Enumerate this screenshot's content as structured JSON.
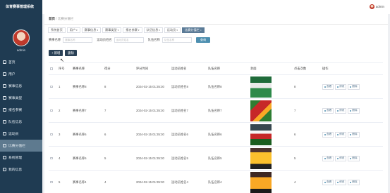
{
  "app": {
    "title": "体育赛事管理系统"
  },
  "user": {
    "name": "admin"
  },
  "sidebar": {
    "profile_name": "admin",
    "items": [
      {
        "label": "首页",
        "icon": "home-icon"
      },
      {
        "label": "用户",
        "icon": "user-icon"
      },
      {
        "label": "赛事信息",
        "icon": "info-icon"
      },
      {
        "label": "赛事类型",
        "icon": "type-icon"
      },
      {
        "label": "报名参赛",
        "icon": "signup-icon"
      },
      {
        "label": "队伍信息",
        "icon": "team-icon"
      },
      {
        "label": "运动员",
        "icon": "athlete-icon"
      },
      {
        "label": "比赛分值栏",
        "icon": "score-icon",
        "active": true
      },
      {
        "label": "系统管理",
        "icon": "system-icon"
      },
      {
        "label": "我的信息",
        "icon": "profile-icon"
      }
    ]
  },
  "breadcrumb": {
    "home": "首页",
    "sep": "/",
    "current": "比赛分值栏"
  },
  "tabs": [
    {
      "label": "系统首页",
      "caret": false
    },
    {
      "label": "用户",
      "caret": true
    },
    {
      "label": "赛事信息",
      "caret": true
    },
    {
      "label": "赛事类型",
      "caret": true
    },
    {
      "label": "报名参赛",
      "caret": true
    },
    {
      "label": "队伍信息",
      "caret": true
    },
    {
      "label": "运动员",
      "caret": true
    },
    {
      "label": "比赛分值栏",
      "caret": true,
      "active": true
    }
  ],
  "filters": {
    "f1_label": "赛事名称",
    "f1_placeholder": "赛事名称",
    "f2_label": "运动员姓名",
    "f2_placeholder": "运动员姓名",
    "f3_label": "队伍名称",
    "f3_placeholder": "队伍名称",
    "search_label": "查询"
  },
  "actions": {
    "add": "+ 新增",
    "delete": "删除"
  },
  "table": {
    "headers": [
      "序号",
      "赛事名称",
      "得分",
      "评分时间",
      "运动员姓名",
      "队伍名称",
      "封面",
      "点击次数",
      "操作"
    ],
    "ops": {
      "view": "查看",
      "edit": "修改",
      "delete": "删除"
    },
    "rows": [
      {
        "index": "1",
        "event": "赛事名称8",
        "score": "8",
        "time": "2024-02-15 01:35:30",
        "athlete": "运动员姓名8",
        "team": "队伍名称8",
        "clicks": "8",
        "image": "photo-soccer-team"
      },
      {
        "index": "2",
        "event": "赛事名称7",
        "score": "7",
        "time": "2024-02-15 01:35:30",
        "athlete": "运动员姓名7",
        "team": "队伍名称7",
        "clicks": "7",
        "image": "photo-soccer-red"
      },
      {
        "index": "3",
        "event": "赛事名称6",
        "score": "6",
        "time": "2024-02-15 01:35:30",
        "athlete": "运动员姓名6",
        "team": "队伍名称6",
        "clicks": "6",
        "image": "photo-team-lineup"
      },
      {
        "index": "4",
        "event": "赛事名称5",
        "score": "5",
        "time": "2024-02-15 01:35:30",
        "athlete": "运动员姓名5",
        "team": "队伍名称5",
        "clicks": "5",
        "image": "photo-team-yellow"
      },
      {
        "index": "5",
        "event": "赛事名称4",
        "score": "4",
        "time": "2024-02-15 01:35:30",
        "athlete": "运动员姓名4",
        "team": "队伍名称4",
        "clicks": "4",
        "image": "photo-team-yellow-2"
      }
    ]
  },
  "colors": {
    "sidebar": "#1f3b52",
    "sidebar_active": "#5e7a8f",
    "accent": "#4d8fb0",
    "dark_button": "#2a4156"
  }
}
